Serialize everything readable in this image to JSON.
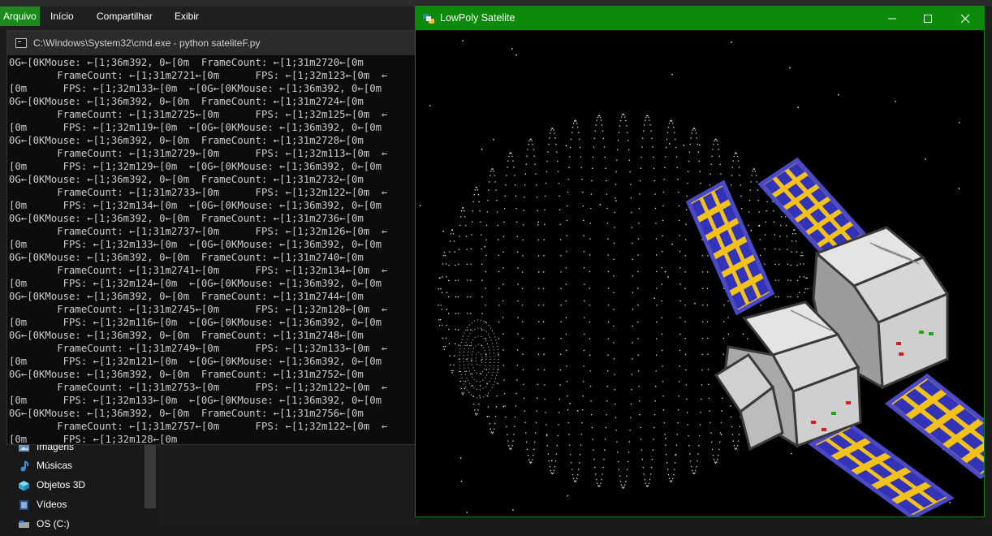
{
  "explorer": {
    "tabs": [
      "Arquivo",
      "Início",
      "Compartilhar",
      "Exibir"
    ],
    "nav_items": [
      {
        "label": "Imagens",
        "icon": "pictures-folder-icon"
      },
      {
        "label": "Músicas",
        "icon": "music-folder-icon"
      },
      {
        "label": "Objetos 3D",
        "icon": "3d-objects-folder-icon"
      },
      {
        "label": "Vídeos",
        "icon": "videos-folder-icon"
      },
      {
        "label": "OS (C:)",
        "icon": "drive-icon"
      }
    ]
  },
  "cmd": {
    "title": "C:\\Windows\\System32\\cmd.exe - python  sateliteF.py",
    "lines": [
      "0G←[0KMouse: ←[1;36m392, 0←[0m  FrameCount: ←[1;31m2720←[0m",
      "        FrameCount: ←[1;31m2721←[0m      FPS: ←[1;32m123←[0m  ←",
      "[0m      FPS: ←[1;32m133←[0m  ←[0G←[0KMouse: ←[1;36m392, 0←[0m",
      "0G←[0KMouse: ←[1;36m392, 0←[0m  FrameCount: ←[1;31m2724←[0m",
      "        FrameCount: ←[1;31m2725←[0m      FPS: ←[1;32m125←[0m  ←",
      "[0m      FPS: ←[1;32m119←[0m  ←[0G←[0KMouse: ←[1;36m392, 0←[0m",
      "0G←[0KMouse: ←[1;36m392, 0←[0m  FrameCount: ←[1;31m2728←[0m",
      "        FrameCount: ←[1;31m2729←[0m      FPS: ←[1;32m113←[0m  ←",
      "[0m      FPS: ←[1;32m129←[0m  ←[0G←[0KMouse: ←[1;36m392, 0←[0m",
      "0G←[0KMouse: ←[1;36m392, 0←[0m  FrameCount: ←[1;31m2732←[0m",
      "        FrameCount: ←[1;31m2733←[0m      FPS: ←[1;32m122←[0m  ←",
      "[0m      FPS: ←[1;32m134←[0m  ←[0G←[0KMouse: ←[1;36m392, 0←[0m",
      "0G←[0KMouse: ←[1;36m392, 0←[0m  FrameCount: ←[1;31m2736←[0m",
      "        FrameCount: ←[1;31m2737←[0m      FPS: ←[1;32m126←[0m  ←",
      "[0m      FPS: ←[1;32m133←[0m  ←[0G←[0KMouse: ←[1;36m392, 0←[0m",
      "0G←[0KMouse: ←[1;36m392, 0←[0m  FrameCount: ←[1;31m2740←[0m",
      "        FrameCount: ←[1;31m2741←[0m      FPS: ←[1;32m134←[0m  ←",
      "[0m      FPS: ←[1;32m124←[0m  ←[0G←[0KMouse: ←[1;36m392, 0←[0m",
      "0G←[0KMouse: ←[1;36m392, 0←[0m  FrameCount: ←[1;31m2744←[0m",
      "        FrameCount: ←[1;31m2745←[0m      FPS: ←[1;32m128←[0m  ←",
      "[0m      FPS: ←[1;32m116←[0m  ←[0G←[0KMouse: ←[1;36m392, 0←[0m",
      "0G←[0KMouse: ←[1;36m392, 0←[0m  FrameCount: ←[1;31m2748←[0m",
      "        FrameCount: ←[1;31m2749←[0m      FPS: ←[1;32m133←[0m  ←",
      "[0m      FPS: ←[1;32m121←[0m  ←[0G←[0KMouse: ←[1;36m392, 0←[0m",
      "0G←[0KMouse: ←[1;36m392, 0←[0m  FrameCount: ←[1;31m2752←[0m",
      "        FrameCount: ←[1;31m2753←[0m      FPS: ←[1;32m122←[0m  ←",
      "[0m      FPS: ←[1;32m133←[0m  ←[0G←[0KMouse: ←[1;36m392, 0←[0m",
      "0G←[0KMouse: ←[1;36m392, 0←[0m  FrameCount: ←[1;31m2756←[0m",
      "        FrameCount: ←[1;31m2757←[0m      FPS: ←[1;32m122←[0m  ←",
      "[0m      FPS: ←[1;32m128←[0m"
    ]
  },
  "satellite_window": {
    "title": "LowPoly Satelite",
    "controls": [
      "minimize-icon",
      "maximize-icon",
      "close-icon"
    ],
    "colors": {
      "titlebar": "#0b8a0b",
      "panel_frame": "#f2c21a",
      "panel_cell": "#3333b8",
      "panel_edge": "#4a4ac8",
      "body_face": "#cfcfcf",
      "body_edge": "#5a5a5a",
      "led_red": "#d21e1e",
      "led_green": "#1eaa1e"
    }
  }
}
